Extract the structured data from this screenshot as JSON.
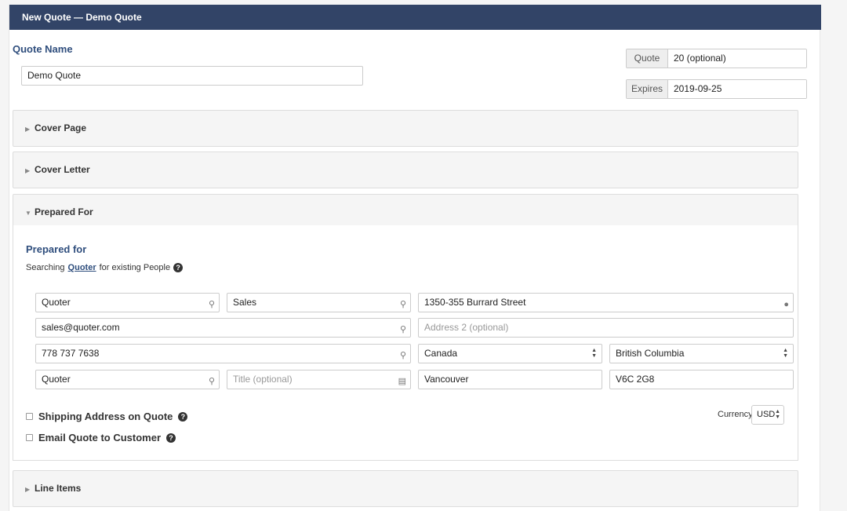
{
  "header": {
    "title": "New Quote — Demo Quote"
  },
  "quote_name": {
    "label": "Quote Name",
    "value": "Demo Quote"
  },
  "quote_number": {
    "addon": "Quote",
    "placeholder": "20 (optional)"
  },
  "expires": {
    "addon": "Expires",
    "value": "2019-09-25"
  },
  "sections": {
    "cover_page": "Cover Page",
    "cover_letter": "Cover Letter",
    "prepared_for": "Prepared For",
    "line_items": "Line Items"
  },
  "prepared_for": {
    "title": "Prepared for",
    "searching_prefix": "Searching",
    "searching_link": "Quoter",
    "searching_suffix": "for existing People",
    "first_name": "Quoter",
    "last_name": "Sales",
    "email": "sales@quoter.com",
    "phone": "778 737 7638",
    "organization": "Quoter",
    "title_placeholder": "Title (optional)",
    "address1": "1350-355 Burrard Street",
    "address2_placeholder": "Address 2 (optional)",
    "country": "Canada",
    "province": "British Columbia",
    "city": "Vancouver",
    "postal": "V6C 2G8",
    "shipping_label": "Shipping Address on Quote",
    "email_label": "Email Quote to Customer",
    "currency_label": "Currency",
    "currency_value": "USD"
  },
  "icons": {
    "search": "search-icon",
    "map_marker": "map-marker-icon",
    "id_card": "id-card-icon",
    "help": "question-circle-icon"
  }
}
